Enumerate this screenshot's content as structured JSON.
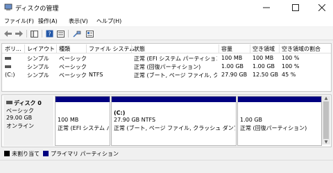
{
  "window": {
    "title": "ディスクの管理"
  },
  "menu": [
    "ファイル(F)",
    "操作(A)",
    "表示(V)",
    "ヘルプ(H)"
  ],
  "toolbar": {
    "icons": [
      "back-arrow-icon",
      "forward-arrow-icon",
      "console-tree-icon",
      "help-icon",
      "properties-icon",
      "connect-icon",
      "settings-icon"
    ]
  },
  "volumes": {
    "headers": [
      "ボリ...",
      "レイアウト",
      "種類",
      "ファイル システム",
      "状態",
      "容量",
      "空き領域",
      "空き領域の割合"
    ],
    "rows": [
      [
        "",
        "シンプル",
        "ベーシック",
        "",
        "正常 (EFI システム パーティション)",
        "100 MB",
        "100 MB",
        "100 %"
      ],
      [
        "",
        "シンプル",
        "ベーシック",
        "",
        "正常 (回復パーティション)",
        "1.00 GB",
        "1.00 GB",
        "100 %"
      ],
      [
        "(C:)",
        "シンプル",
        "ベーシック",
        "NTFS",
        "正常 (ブート, ページ ファイル, クラ...",
        "27.90 GB",
        "12.50 GB",
        "45 %"
      ]
    ]
  },
  "disk": {
    "name": "ディスク 0",
    "type": "ベーシック",
    "size": "29.00 GB",
    "status": "オンライン",
    "partitions": [
      {
        "title": "",
        "line1": "100 MB",
        "line2": "正常 (EFI システム パ"
      },
      {
        "title": "(C:)",
        "line1": "27.90 GB NTFS",
        "line2": "正常 (ブート, ページ ファイル, クラッシュ ダンプ, プラ"
      },
      {
        "title": "",
        "line1": "1.00 GB",
        "line2": "正常 (回復パーティション)"
      }
    ]
  },
  "legend": {
    "unallocated": "未割り当て",
    "primary": "プライマリ パーティション"
  },
  "colors": {
    "primary_bar": "#000080",
    "unallocated": "#000000"
  }
}
